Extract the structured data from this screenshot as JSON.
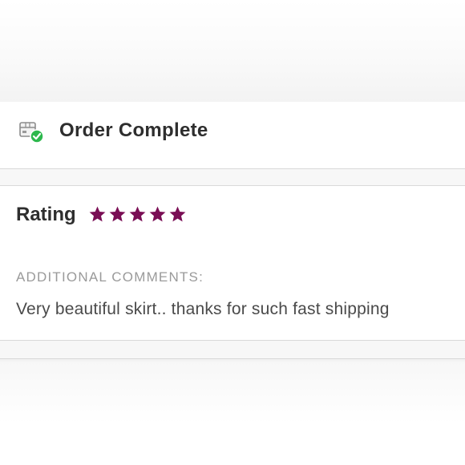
{
  "status": {
    "title": "Order Complete",
    "icon": "package-check-icon",
    "check_color": "#2db84d"
  },
  "review": {
    "rating_label": "Rating",
    "rating_value": 5,
    "rating_max": 5,
    "star_color": "#7a0e55",
    "comments_heading": "ADDITIONAL COMMENTS:",
    "comment": "Very beautiful skirt.. thanks for such fast shipping"
  }
}
